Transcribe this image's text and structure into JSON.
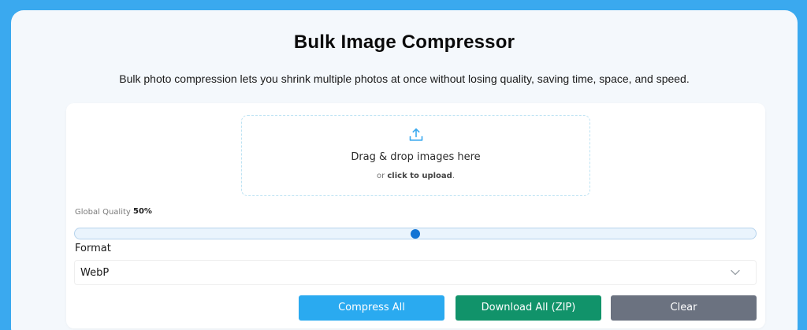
{
  "header": {
    "title": "Bulk Image Compressor",
    "subtitle": "Bulk photo compression lets you shrink multiple photos at once without losing quality, saving time, space, and speed."
  },
  "dropzone": {
    "icon": "upload-icon",
    "title": "Drag & drop images here",
    "prefix": "or",
    "link": "click to upload",
    "suffix": "."
  },
  "quality": {
    "label": "Global Quality",
    "value_text": "50%",
    "value": 0.5
  },
  "format": {
    "label": "Format",
    "selected": "WebP",
    "icon": "chevron-down-icon"
  },
  "actions": {
    "compress": "Compress All",
    "download": "Download All (ZIP)",
    "clear": "Clear"
  },
  "colors": {
    "page_background": "#3aa9ef",
    "compress": "#2aaaf0",
    "download": "#11936a",
    "clear": "#6b7280",
    "slider_thumb": "#1173d4"
  }
}
